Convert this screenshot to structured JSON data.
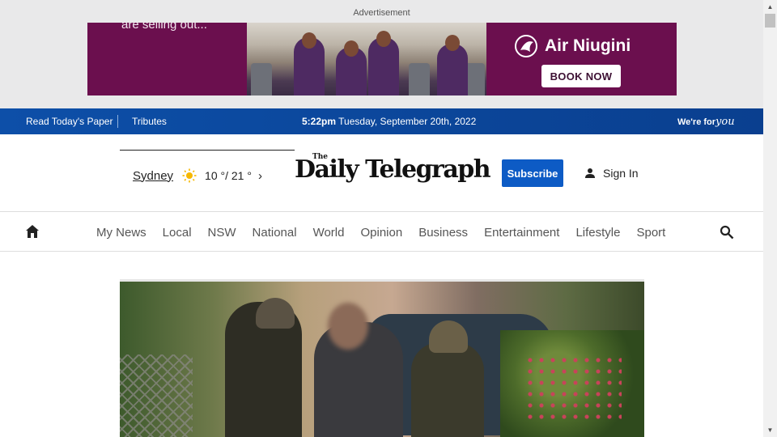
{
  "ad": {
    "label": "Advertisement",
    "tagline": "are selling out...",
    "brand": "Air Niugini",
    "cta": "BOOK NOW",
    "colors": {
      "background": "#6b0f4e",
      "cta_text": "#3d1033"
    }
  },
  "topbar": {
    "read_paper": "Read Today's Paper",
    "tributes": "Tributes",
    "time": "5:22pm",
    "date": "Tuesday, September 20th, 2022",
    "slogan_prefix": "We're for",
    "slogan_script": "you",
    "color": "#0d4fa8"
  },
  "header": {
    "weather": {
      "city": "Sydney",
      "icon": "sun-icon",
      "temp": "10 °/ 21 °"
    },
    "logo": {
      "the": "The",
      "name": "Daily Telegraph"
    },
    "subscribe": "Subscribe",
    "sign_in": "Sign In",
    "accent": "#0d5bc5"
  },
  "nav": {
    "items": [
      {
        "label": "My News"
      },
      {
        "label": "Local"
      },
      {
        "label": "NSW"
      },
      {
        "label": "National"
      },
      {
        "label": "World"
      },
      {
        "label": "Opinion"
      },
      {
        "label": "Business"
      },
      {
        "label": "Entertainment"
      },
      {
        "label": "Lifestyle"
      },
      {
        "label": "Sport"
      }
    ]
  }
}
